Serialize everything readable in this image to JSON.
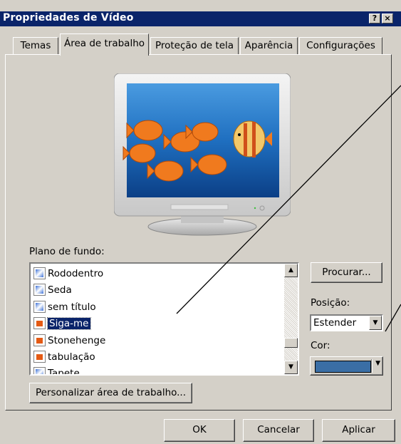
{
  "window": {
    "title": "Propriedades de Vídeo"
  },
  "caption_buttons": {
    "help": "?",
    "close": "×"
  },
  "tabs": [
    {
      "label": "Temas"
    },
    {
      "label": "Área de trabalho",
      "active": true
    },
    {
      "label": "Proteção de tela"
    },
    {
      "label": "Aparência"
    },
    {
      "label": "Configurações"
    }
  ],
  "background": {
    "label": "Plano de fundo:",
    "items": [
      {
        "label": "Rododentro",
        "icon": "image-file-icon"
      },
      {
        "label": "Seda",
        "icon": "image-file-icon"
      },
      {
        "label": "sem título",
        "icon": "image-file-icon"
      },
      {
        "label": "Siga-me",
        "icon": "html-file-icon",
        "selected": true
      },
      {
        "label": "Stonehenge",
        "icon": "html-file-icon"
      },
      {
        "label": "tabulação",
        "icon": "html-file-icon"
      },
      {
        "label": "Tapete",
        "icon": "image-file-icon"
      }
    ],
    "scroll_up": "▲",
    "scroll_down": "▼"
  },
  "browse_button": "Procurar...",
  "position": {
    "label": "Posição:",
    "value": "Estender",
    "arrow": "▼"
  },
  "color": {
    "label": "Cor:",
    "value": "#3a6ea5",
    "arrow": "▼"
  },
  "customize_button": "Personalizar área de trabalho...",
  "footer": {
    "ok": "OK",
    "cancel": "Cancelar",
    "apply": "Aplicar"
  },
  "colors": {
    "titlebar": "#0a246a",
    "dialog": "#d4d0c8",
    "selection": "#0a246a",
    "desktop_preview": "#1f6fc0"
  }
}
